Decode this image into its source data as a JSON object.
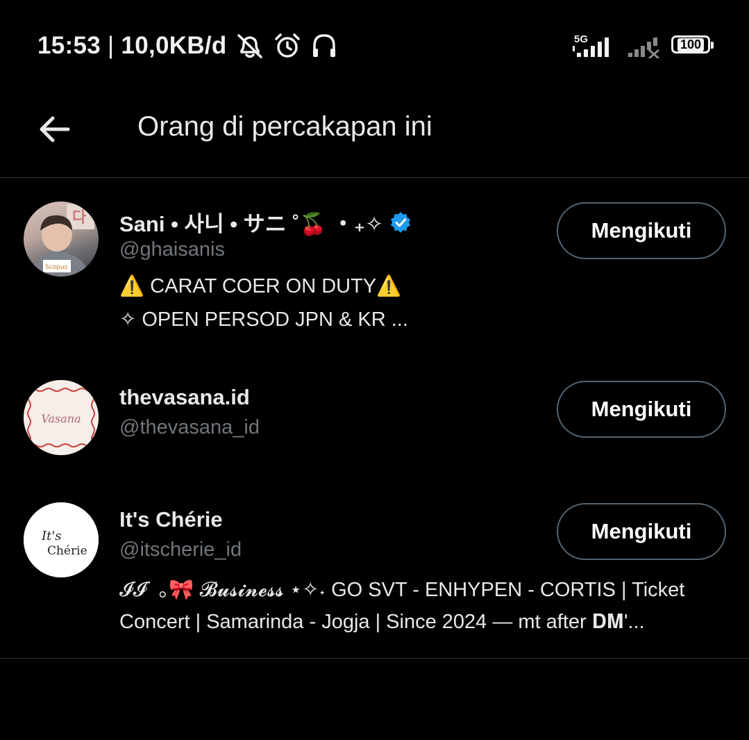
{
  "status_bar": {
    "time": "15:53",
    "separator": "|",
    "net_speed": "10,0KB/d",
    "network_type": "5G",
    "battery_level": "100",
    "icons": [
      "notifications-off-icon",
      "alarm-icon",
      "headphones-icon",
      "signal-5g-icon",
      "signal-no-service-icon",
      "battery-icon"
    ]
  },
  "header": {
    "back_icon": "arrow-left-icon",
    "title": "Orang di percakapan ini"
  },
  "users": [
    {
      "display_name": "Sani • 사니 • サニ ˚🍒 ・₊✧",
      "verified": true,
      "handle": "@ghaisanis",
      "bio_lines": [
        "⚠️ CARAT COER ON DUTY⚠️",
        "✧ OPEN PERSOD JPN & KR ..."
      ],
      "follow_label": "Mengikuti",
      "avatar_badge": "Scopus"
    },
    {
      "display_name": "thevasana.id",
      "verified": false,
      "handle": "@thevasana_id",
      "bio_lines": [],
      "follow_label": "Mengikuti",
      "avatar_text": "Vasana"
    },
    {
      "display_name": "It's Chérie",
      "verified": false,
      "handle": "@itscherie_id",
      "bio_lines": [
        "𝓘𝓘˙ ｡🎀 𝓑𝓾𝓼𝓲𝓷𝓮𝓼𝓼 ⋆✧˖ GO SVT - ENHYPEN - CORTIS | Ticket",
        "Concert | Samarinda - Jogja | Since 2024 — mt after 𝐃𝐌'..."
      ],
      "follow_label": "Mengikuti",
      "avatar_text_1": "It's",
      "avatar_text_2": "Chérie"
    }
  ],
  "colors": {
    "background": "#000000",
    "primary_text": "#e7e9ea",
    "secondary_text": "#71767b",
    "border": "#2f3336",
    "button_border": "#536471",
    "verified_blue": "#1d9bf0"
  }
}
